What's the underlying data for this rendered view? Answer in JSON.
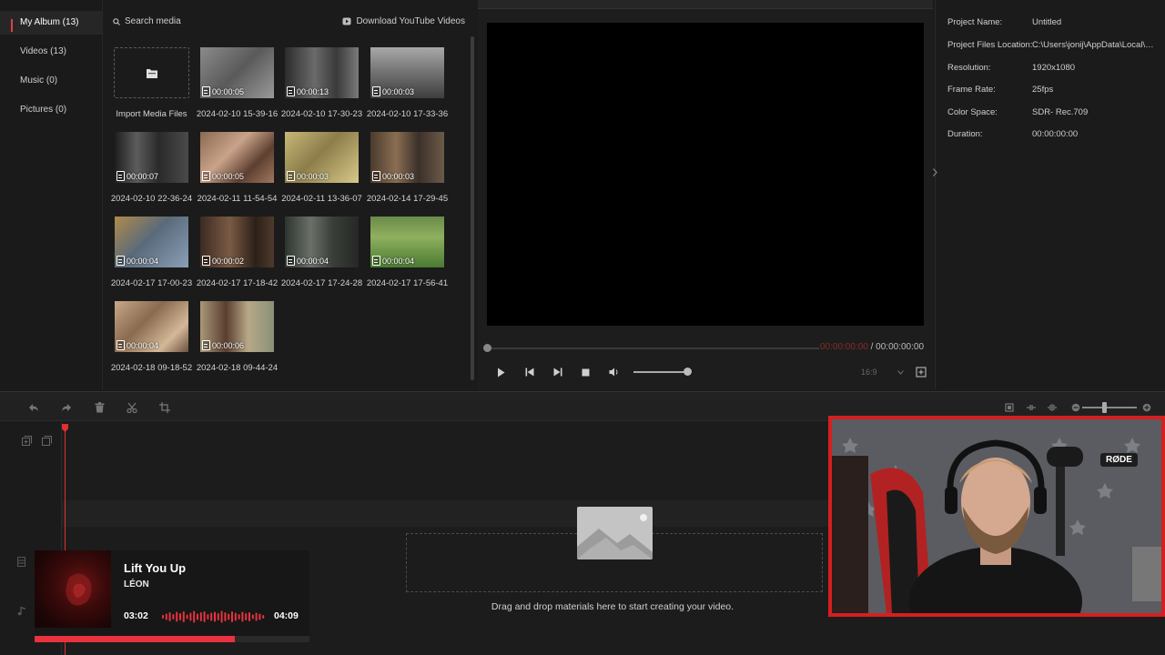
{
  "sidebar": {
    "items": [
      {
        "label": "My Album (13)",
        "active": true
      },
      {
        "label": "Videos (13)"
      },
      {
        "label": "Music (0)"
      },
      {
        "label": "Pictures (0)"
      }
    ]
  },
  "media": {
    "search_label": "Search media",
    "download_label": "Download YouTube Videos",
    "import_label": "Import Media Files",
    "clips": [
      {
        "name": "2024-02-10 15-39-16",
        "duration": "00:00:05"
      },
      {
        "name": "2024-02-10 17-30-23",
        "duration": "00:00:13"
      },
      {
        "name": "2024-02-10 17-33-36",
        "duration": "00:00:03"
      },
      {
        "name": "2024-02-10 22-36-24",
        "duration": "00:00:07"
      },
      {
        "name": "2024-02-11 11-54-54",
        "duration": "00:00:05"
      },
      {
        "name": "2024-02-11 13-36-07",
        "duration": "00:00:03"
      },
      {
        "name": "2024-02-14 17-29-45",
        "duration": "00:00:03"
      },
      {
        "name": "2024-02-17 17-00-23",
        "duration": "00:00:04"
      },
      {
        "name": "2024-02-17 17-18-42",
        "duration": "00:00:02"
      },
      {
        "name": "2024-02-17 17-24-28",
        "duration": "00:00:04"
      },
      {
        "name": "2024-02-17 17-56-41",
        "duration": "00:00:04"
      },
      {
        "name": "2024-02-18 09-18-52",
        "duration": "00:00:04"
      },
      {
        "name": "2024-02-18 09-44-24",
        "duration": "00:00:06"
      }
    ]
  },
  "preview": {
    "current_time": "00:00:00:00",
    "separator": " / ",
    "total_time": "00:00:00:00",
    "aspect_ratio": "16:9",
    "volume_level": 1.0
  },
  "project": {
    "rows": [
      {
        "key": "Project Name:",
        "value": "Untitled"
      },
      {
        "key": "Project Files Location:",
        "value": "C:\\Users\\jonij\\AppData\\Local\\Mini..."
      },
      {
        "key": "Resolution:",
        "value": "1920x1080"
      },
      {
        "key": "Frame Rate:",
        "value": "25fps"
      },
      {
        "key": "Color Space:",
        "value": "SDR- Rec.709"
      },
      {
        "key": "Duration:",
        "value": "00:00:00:00"
      }
    ]
  },
  "timeline": {
    "drop_text": "Drag and drop materials here to start creating your video."
  },
  "music_widget": {
    "title": "Lift You Up",
    "artist": "LÉON",
    "elapsed": "03:02",
    "total": "04:09",
    "progress": 0.73
  },
  "webcam": {
    "mic_brand": "RØDE"
  },
  "colors": {
    "accent_red": "#e03030",
    "webcam_border": "#d61f1f"
  }
}
